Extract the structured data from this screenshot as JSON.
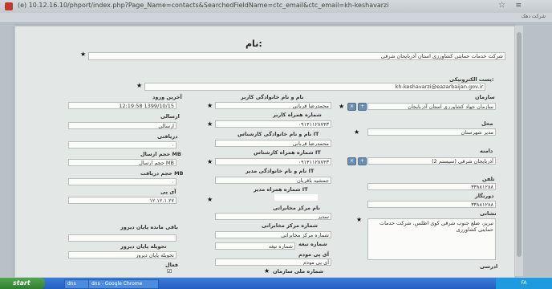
{
  "browser": {
    "url": "(e) 10.12.16.10/phport/index.php?Page_Name=contacts&SearchedFieldName=ctc_email&ctc_email=kh-keshavarzi",
    "tab_label": "شرکت دهک"
  },
  "form": {
    "title": "نام:",
    "company_name": "شرکت خدمات حمایتی کشاورزی استان آذربایجان شرقی",
    "email_label": "پست الکترونیکی:",
    "email_value": "kh-keshavarzi@eazarbaijan.gov.ir",
    "right_col": {
      "organization_label": "سازمان",
      "organization_value": "سازمان جهاد کشاورزی استان آذربایجان",
      "location_label": "محل",
      "location_value": "مدیر شهرستان",
      "domain_label": "دامنه",
      "domain_value": "آذربایجان شرقی (سیستم 2)",
      "phone_label": "تلفن",
      "phone_value": "۳۳۸۸۱۲۸۸",
      "extension_label": "دورنگار",
      "extension_value": "۳۳۸۸۱۲۸۸",
      "address_label": "نشانی",
      "address_value": "تبریز، ضلع جنوب شرقی کوی اطلس، شرکت خدمات حمایتی کشاورزی",
      "more_label": "ادرسی"
    },
    "mid_col": {
      "user_label": "نام و نام خانوادگی کاربر",
      "user_value": "محمدرضا قربانی",
      "user_mobile_label": "شماره همراه کاربر",
      "user_mobile_value": "۰۹۱۴۱۱۲۸۷۴۳",
      "it1_name_label": "نام و نام خانوادگی کارشناس IT",
      "it1_name_value": "محمدرضا قربانی",
      "it1_mobile_label": "شماره همراه کارشناس IT",
      "it1_mobile_value": "۰۹۱۴۱۱۲۸۷۴۳",
      "it_mgr_label": "نام و نام خانوادگی مدیر IT",
      "it_mgr_value": "جمشید باقریان",
      "it_mgr_mobile_label": "شماره همراه مدیر IT",
      "comm_center_label": "نام مرکز مخابراتی",
      "comm_center_value": "سدیر",
      "comm_number_label": "شماره مرکز مخابراتی",
      "comm_number_value": "شماره مرکز مخابراتی",
      "line_label": "شماره تیغه",
      "line_value": "شماره تیغه",
      "modem_ip_label": "آی پی مودم",
      "modem_ip_value": "آی پی مودم",
      "national_code_label": "شماره ملی سازمان"
    },
    "left_col": {
      "last_login_label": "آخرین ورود",
      "last_login_value": "12:19:58 1399/10/15",
      "sent_label": "ارسالی",
      "sent_value": "ارسالی",
      "received_label": "دریافتی",
      "received_value": "۰",
      "send_size_label": "حجم ارسال MB",
      "send_size_value": "حجم ارسال MB",
      "recv_size_label": "حجم دریافت MB",
      "recv_size_value": "۰",
      "ip_label": "آی پی",
      "ip_value": "۱۲.۱۲.۱.۲۷",
      "remaining_label": "باقی مانده پایان دیروز",
      "end_label": "تحویله پایان دیروز",
      "end_value": "تحویله پایان دیروز",
      "active_label": "فعال",
      "active_check": "☑"
    }
  },
  "taskbar": {
    "start": "start",
    "task1": "dns",
    "task2": "dns - Google Chrome",
    "tray_label": "FA"
  }
}
